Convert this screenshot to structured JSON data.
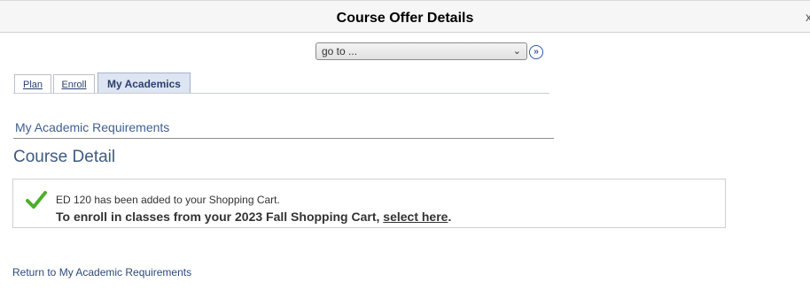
{
  "window": {
    "title": "Course Offer Details",
    "close_glyph": "x"
  },
  "nav": {
    "goto_value": "go to ...",
    "goto_chevron_icon": "chevron-down-icon",
    "go_button_icon": "double-chevron-right-icon"
  },
  "tabs": [
    {
      "label": "Plan",
      "active": false
    },
    {
      "label": "Enroll",
      "active": false
    },
    {
      "label": "My Academics",
      "active": true
    }
  ],
  "section": {
    "heading": "My Academic Requirements"
  },
  "page": {
    "title": "Course Detail"
  },
  "message": {
    "icon": "checkmark-icon",
    "icon_color": "#4caf2a",
    "line1": "ED  120 has been added to your Shopping Cart.",
    "line2_prefix": "To enroll in classes from your 2023 Fall Shopping Cart, ",
    "line2_link": "select here",
    "line2_suffix": "."
  },
  "footer": {
    "return_link": "Return to My Academic Requirements"
  },
  "colors": {
    "link": "#2b4a7e",
    "heading": "#3e5a82",
    "active_tab_bg": "#dde5f2"
  }
}
